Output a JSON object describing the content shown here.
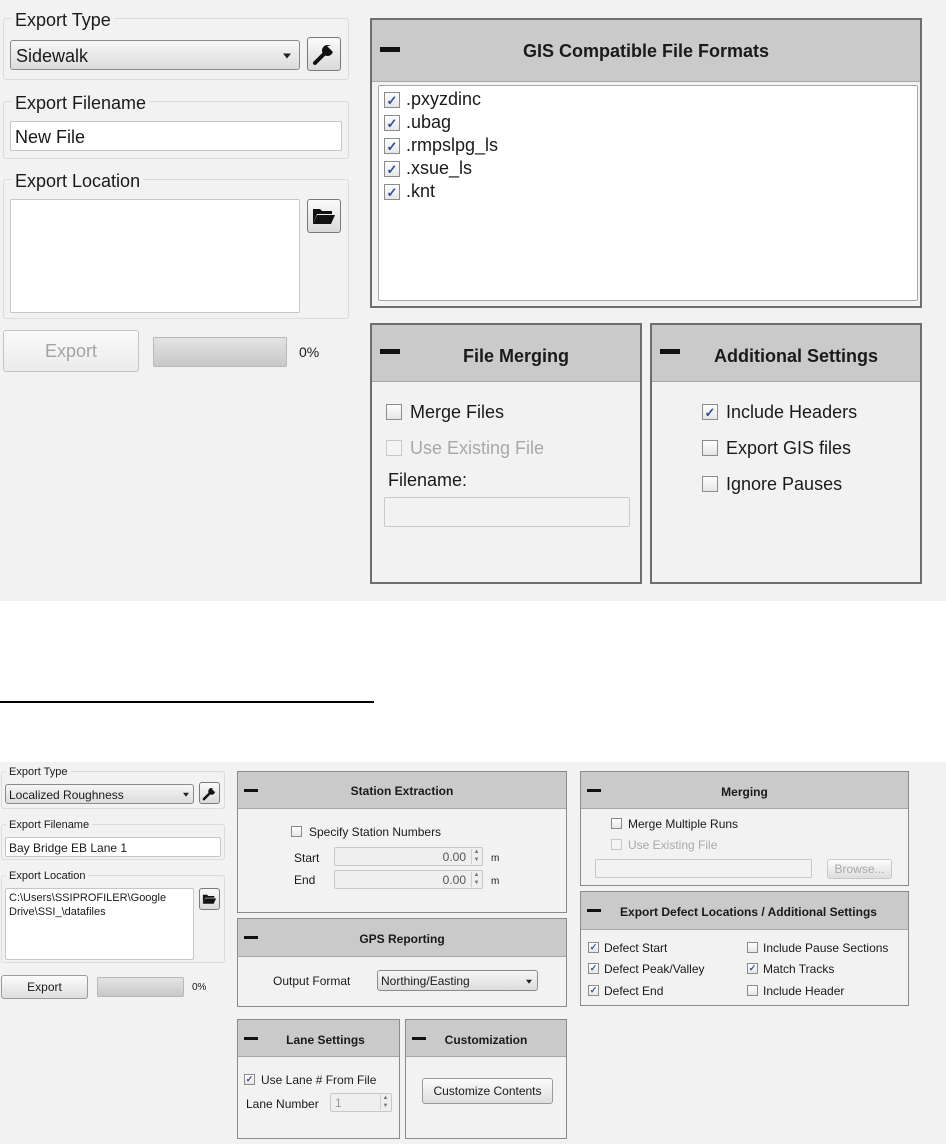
{
  "top": {
    "export_type": {
      "legend": "Export Type",
      "selected": "Sidewalk"
    },
    "export_filename": {
      "legend": "Export Filename",
      "value": "New File"
    },
    "export_location": {
      "legend": "Export Location",
      "value": ""
    },
    "export_button": "Export",
    "progress_value": 0,
    "progress_label": "0%",
    "gis_panel": {
      "title": "GIS Compatible File Formats",
      "formats": [
        {
          "label": ".pxyzdinc",
          "checked": true
        },
        {
          "label": ".ubag",
          "checked": true
        },
        {
          "label": ".rmpslpg_ls",
          "checked": true
        },
        {
          "label": ".xsue_ls",
          "checked": true
        },
        {
          "label": ".knt",
          "checked": true
        }
      ]
    },
    "file_merging": {
      "title": "File Merging",
      "merge_files": {
        "label": "Merge Files",
        "checked": false
      },
      "use_existing": {
        "label": "Use Existing File",
        "checked": false,
        "disabled": true
      },
      "filename_label": "Filename:",
      "filename_value": ""
    },
    "additional_settings": {
      "title": "Additional Settings",
      "include_headers": {
        "label": "Include Headers",
        "checked": true
      },
      "export_gis": {
        "label": "Export GIS files",
        "checked": false
      },
      "ignore_pauses": {
        "label": "Ignore Pauses",
        "checked": false
      }
    }
  },
  "bottom": {
    "export_type": {
      "legend": "Export Type",
      "selected": "Localized Roughness"
    },
    "export_filename": {
      "legend": "Export Filename",
      "value": "Bay Bridge EB Lane 1"
    },
    "export_location": {
      "legend": "Export Location",
      "line1": "C:\\Users\\SSIPROFILER\\Google",
      "line2": "Drive\\SSI_\\datafiles"
    },
    "export_button": "Export",
    "progress_value": 0,
    "progress_label": "0%",
    "station_extraction": {
      "title": "Station Extraction",
      "specify": {
        "label": "Specify Station Numbers",
        "checked": false
      },
      "start_label": "Start",
      "start_value": "0.00",
      "end_label": "End",
      "end_value": "0.00",
      "unit": "m"
    },
    "gps_reporting": {
      "title": "GPS Reporting",
      "output_label": "Output Format",
      "output_value": "Northing/Easting"
    },
    "lane_settings": {
      "title": "Lane Settings",
      "use_lane": {
        "label": "Use Lane # From File",
        "checked": true
      },
      "lane_number_label": "Lane Number",
      "lane_number_value": "1"
    },
    "customization": {
      "title": "Customization",
      "button": "Customize Contents"
    },
    "merging": {
      "title": "Merging",
      "merge_runs": {
        "label": "Merge Multiple Runs",
        "checked": false
      },
      "use_existing": {
        "label": "Use Existing File",
        "checked": false,
        "disabled": true
      },
      "filename_value": "",
      "browse_button": "Browse..."
    },
    "defect_settings": {
      "title": "Export Defect Locations / Additional Settings",
      "defect_start": {
        "label": "Defect Start",
        "checked": true
      },
      "defect_peak": {
        "label": "Defect Peak/Valley",
        "checked": true
      },
      "defect_end": {
        "label": "Defect End",
        "checked": true
      },
      "include_pause": {
        "label": "Include Pause Sections",
        "checked": false
      },
      "match_tracks": {
        "label": "Match Tracks",
        "checked": true
      },
      "include_header": {
        "label": "Include Header",
        "checked": false
      }
    }
  }
}
